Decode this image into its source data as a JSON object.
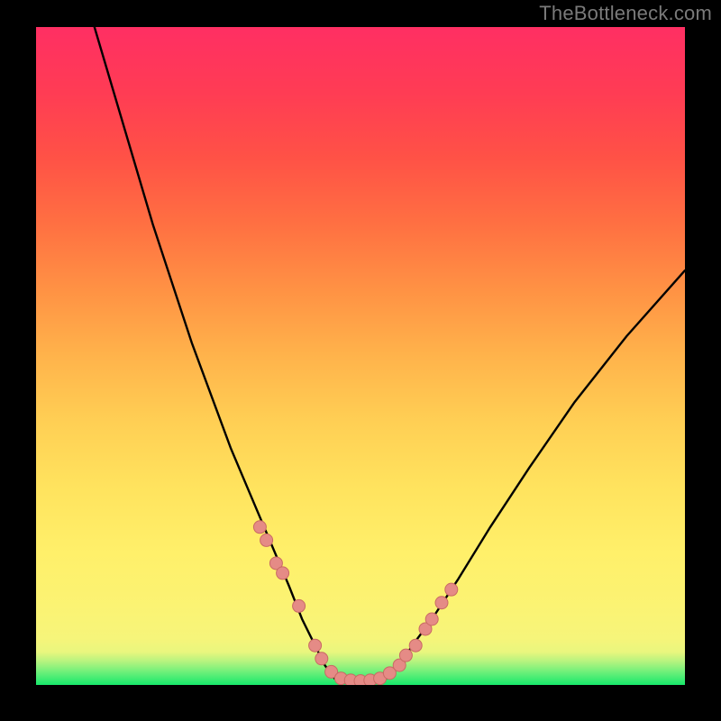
{
  "watermark": "TheBottleneck.com",
  "chart_data": {
    "type": "line",
    "title": "",
    "xlabel": "",
    "ylabel": "",
    "xlim": [
      0,
      100
    ],
    "ylim": [
      0,
      100
    ],
    "grid": false,
    "legend": false,
    "series": [
      {
        "name": "left-curve",
        "x": [
          9,
          12,
          15,
          18,
          21,
          24,
          27,
          30,
          33,
          36,
          39,
          41,
          43,
          44.5,
          46
        ],
        "y": [
          100,
          90,
          80,
          70,
          61,
          52,
          44,
          36,
          29,
          22,
          15,
          10,
          6,
          3,
          1
        ]
      },
      {
        "name": "flat-bottom",
        "x": [
          46,
          48,
          50,
          52,
          54
        ],
        "y": [
          1,
          0.5,
          0.5,
          0.5,
          1
        ]
      },
      {
        "name": "right-curve",
        "x": [
          54,
          56,
          58,
          61,
          65,
          70,
          76,
          83,
          91,
          100
        ],
        "y": [
          1,
          3,
          6,
          10,
          16,
          24,
          33,
          43,
          53,
          63
        ]
      }
    ],
    "points": {
      "name": "dots",
      "x": [
        34.5,
        35.5,
        37,
        38,
        40.5,
        43,
        44,
        45.5,
        47,
        48.5,
        50,
        51.5,
        53,
        54.5,
        56,
        57,
        58.5,
        60,
        61,
        62.5,
        64
      ],
      "y": [
        24,
        22,
        18.5,
        17,
        12,
        6,
        4,
        2,
        1,
        0.7,
        0.6,
        0.7,
        1,
        1.8,
        3,
        4.5,
        6,
        8.5,
        10,
        12.5,
        14.5
      ]
    },
    "gradient_stops": [
      {
        "pos": 0,
        "color": "#17e86b"
      },
      {
        "pos": 5,
        "color": "#e9f67e"
      },
      {
        "pos": 20,
        "color": "#fff06a"
      },
      {
        "pos": 50,
        "color": "#ffb34b"
      },
      {
        "pos": 80,
        "color": "#ff5246"
      },
      {
        "pos": 100,
        "color": "#ff2f63"
      }
    ],
    "colors": {
      "curve": "#000000",
      "dot_fill": "#e58b86",
      "dot_stroke": "#c96a64",
      "frame": "#000000"
    }
  }
}
